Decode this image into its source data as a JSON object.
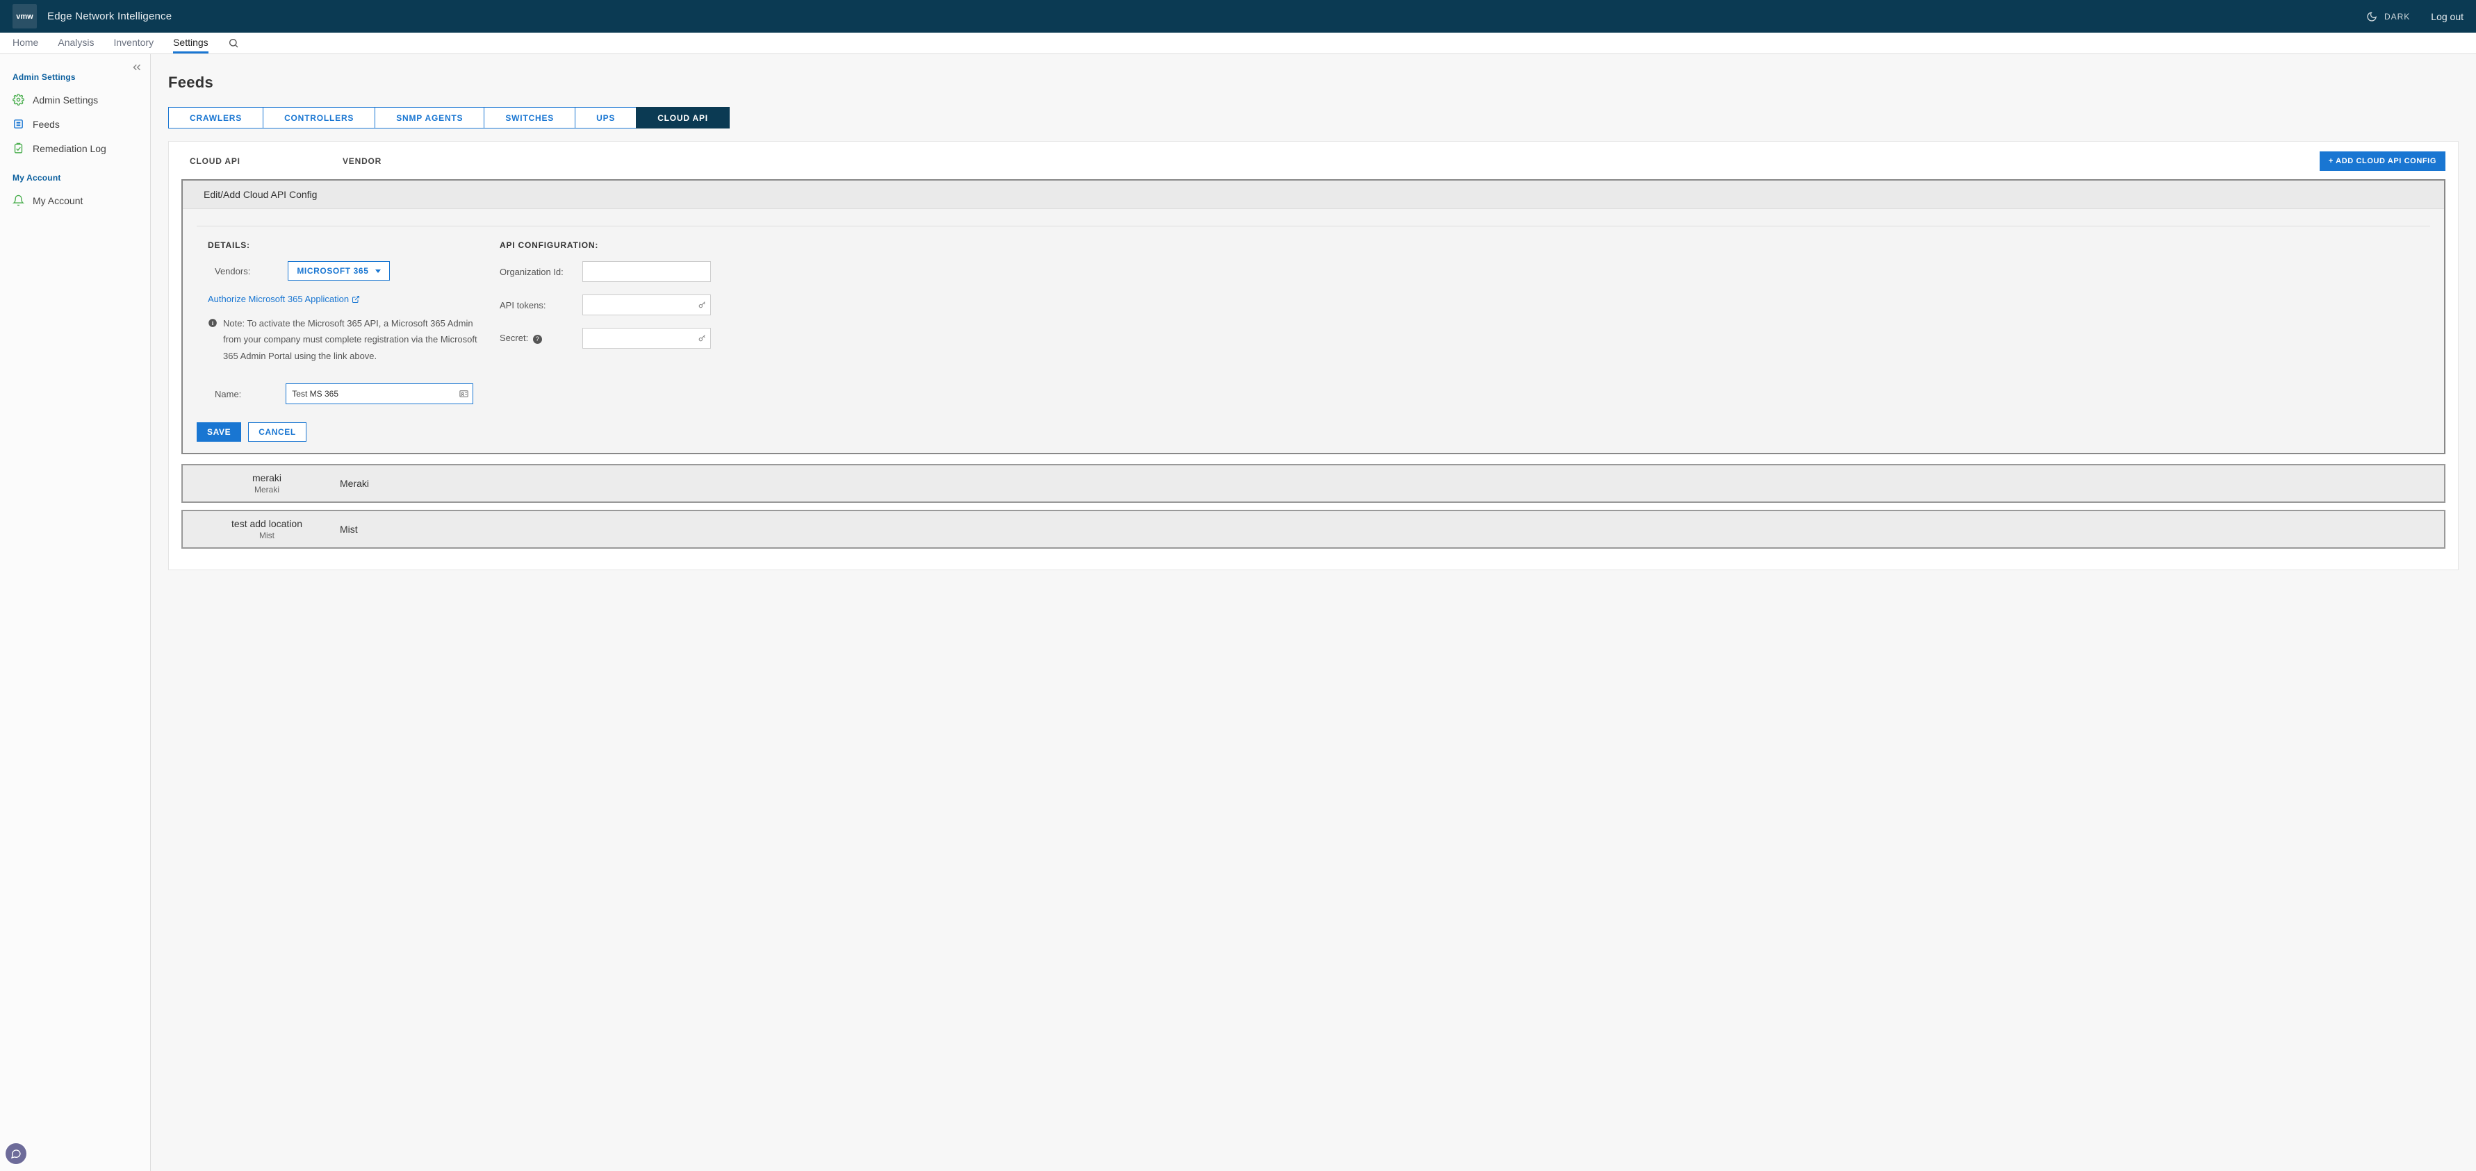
{
  "header": {
    "logo_text": "vmw",
    "app_title": "Edge Network Intelligence",
    "dark_label": "DARK",
    "logout_label": "Log out"
  },
  "nav": {
    "items": [
      "Home",
      "Analysis",
      "Inventory",
      "Settings"
    ],
    "active_index": 3
  },
  "sidebar": {
    "section1_title": "Admin Settings",
    "items1": [
      "Admin Settings",
      "Feeds",
      "Remediation Log"
    ],
    "section2_title": "My Account",
    "items2": [
      "My Account"
    ]
  },
  "page": {
    "title": "Feeds",
    "tabs": [
      "CRAWLERS",
      "CONTROLLERS",
      "SNMP AGENTS",
      "SWITCHES",
      "UPS",
      "CLOUD API"
    ],
    "active_tab_index": 5,
    "columns": {
      "col1": "CLOUD API",
      "col2": "VENDOR"
    },
    "add_button": "+ ADD CLOUD API CONFIG",
    "edit_header": "Edit/Add Cloud API Config",
    "details": {
      "title": "DETAILS:",
      "vendor_label": "Vendors:",
      "vendor_value": "MICROSOFT 365",
      "authorize_link": "Authorize Microsoft 365 Application",
      "note": "Note: To activate the Microsoft 365 API, a Microsoft 365 Admin from your company must complete registration via the Microsoft 365 Admin Portal using the link above.",
      "name_label": "Name:",
      "name_value": "Test MS 365"
    },
    "api_config": {
      "title": "API CONFIGURATION:",
      "org_label": "Organization Id:",
      "org_value": "",
      "tokens_label": "API tokens:",
      "tokens_value": "",
      "secret_label": "Secret:",
      "secret_value": ""
    },
    "buttons": {
      "save": "SAVE",
      "cancel": "CANCEL"
    },
    "rows": [
      {
        "name": "meraki",
        "sub": "Meraki",
        "vendor": "Meraki"
      },
      {
        "name": "test add location",
        "sub": "Mist",
        "vendor": "Mist"
      }
    ]
  }
}
